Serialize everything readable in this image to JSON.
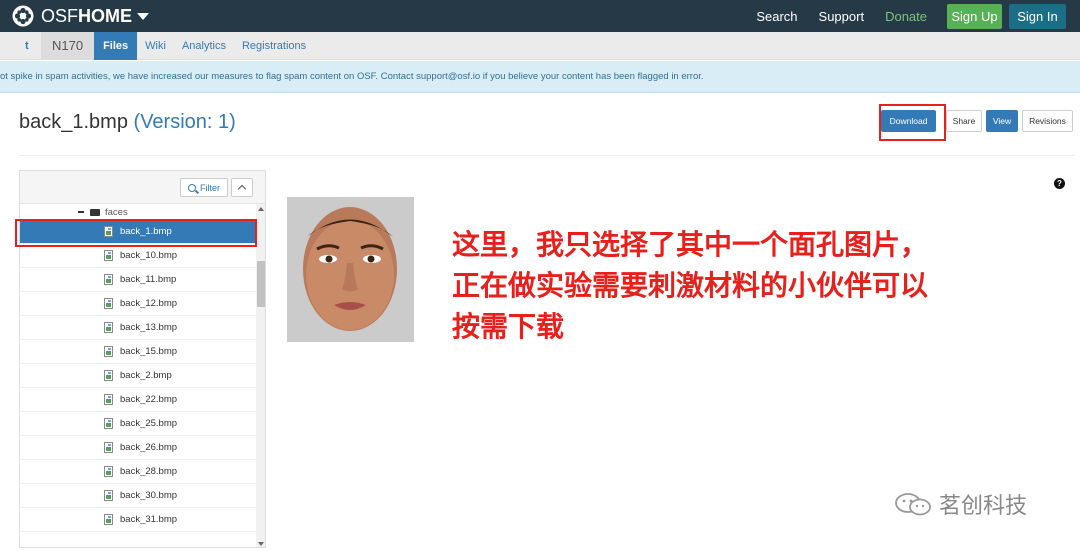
{
  "brand": {
    "prefix": "OSF",
    "suffix": "HOME"
  },
  "topnav": {
    "search": "Search",
    "support": "Support",
    "donate": "Donate",
    "sign_up": "Sign Up",
    "sign_in": "Sign In"
  },
  "projnav": {
    "abbr": "t",
    "project": "N170",
    "tabs": [
      "Files",
      "Wiki",
      "Analytics",
      "Registrations"
    ]
  },
  "alert": {
    "text": "ot spike in spam activities, we have increased our measures to flag spam content on OSF. Contact support@osf.io if you believe your content has been flagged in error."
  },
  "file": {
    "name": "back_1.bmp",
    "version": "(Version: 1)"
  },
  "actions": {
    "download": "Download",
    "share": "Share",
    "view": "View",
    "revisions": "Revisions"
  },
  "filetree": {
    "filter": "Filter",
    "folder": "faces",
    "files": [
      "back_1.bmp",
      "back_10.bmp",
      "back_11.bmp",
      "back_12.bmp",
      "back_13.bmp",
      "back_15.bmp",
      "back_2.bmp",
      "back_22.bmp",
      "back_25.bmp",
      "back_26.bmp",
      "back_28.bmp",
      "back_30.bmp",
      "back_31.bmp"
    ],
    "selected_index": 0
  },
  "help": "?",
  "annotation": {
    "lines": [
      "这里，我只选择了其中一个面孔图片，",
      "正在做实验需要刺激材料的小伙伴可以",
      "按需下载"
    ]
  },
  "watermark": {
    "text": "茗创科技"
  },
  "colors": {
    "annotation": "#e8201c",
    "navbar": "#263947",
    "primary": "#337ab7",
    "signup": "#57b157",
    "signin": "#1b6e85"
  }
}
